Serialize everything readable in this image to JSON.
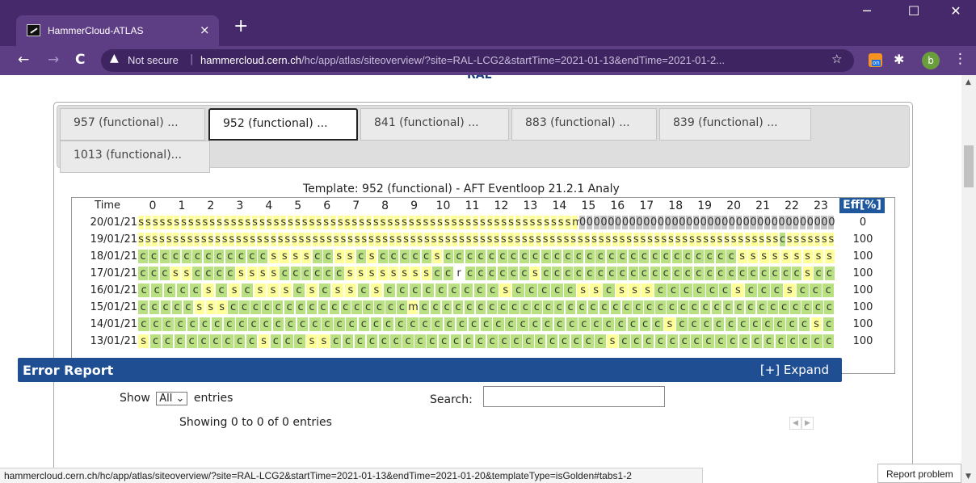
{
  "browser": {
    "tab_title": "HammerCloud-ATLAS",
    "tab_close": "×",
    "new_tab": "+",
    "window_controls": [
      "─",
      "☐",
      "✕"
    ],
    "nav": {
      "back": "←",
      "forward": "→",
      "reload": "C"
    },
    "security_label": "Not secure",
    "url_host": "hammercloud.cern.ch",
    "url_path": "/hc/app/atlas/siteoverview/?site=RAL-LCG2&startTime=2021-01-13&endTime=2021-01-2...",
    "bookmark_icon": "☆",
    "extension_badge": "on",
    "profile_initial": "b",
    "menu_icon": "⋮",
    "status_url": "hammercloud.cern.ch/hc/app/atlas/siteoverview/?site=RAL-LCG2&startTime=2021-01-13&endTime=2021-01-20&templateType=isGolden#tabs1-2"
  },
  "page": {
    "site_heading": "RAL",
    "template_tabs": [
      "957 (functional) ...",
      "952 (functional) ...",
      "841 (functional) ...",
      "883 (functional) ...",
      "839 (functional) ...",
      "1013 (functional)..."
    ],
    "active_tab": 1,
    "template_title": "Template: 952 (functional) - AFT Eventloop 21.2.1 Analy",
    "grid": {
      "time_label": "Time",
      "hours": [
        "0",
        "1",
        "2",
        "3",
        "4",
        "5",
        "6",
        "7",
        "8",
        "9",
        "10",
        "11",
        "12",
        "13",
        "14",
        "15",
        "16",
        "17",
        "18",
        "19",
        "20",
        "21",
        "22",
        "23"
      ],
      "eff_label": "Eff[%]",
      "rows": [
        {
          "date": "20/01/21",
          "eff": "0",
          "cells": "sssssssssssssssssssssssssssssssssssssssssssssssssssssssssssssm000000000000000000000000000000000000"
        },
        {
          "date": "19/01/21",
          "eff": "100",
          "cells": "sssssssssssssssssssssssssssssssssssssssssssssssssssssssssssssssssssssssssssssssssssssssssssscsssssss"
        },
        {
          "date": "18/01/21",
          "eff": "100",
          "cells": "ccccccccccccssssccsscscccccscccccccccccccccccccccccccccsssssssss"
        },
        {
          "date": "17/01/21",
          "eff": "100",
          "cells": "cccssccccssssccccccssssssssccrccccccsccccccccccccccccccccccccscc"
        },
        {
          "date": "16/01/21",
          "eff": "100",
          "cells": "cccccscscssscscsscscccccccccscccccsscsssccccccscccsccc"
        },
        {
          "date": "15/01/21",
          "eff": "100",
          "cells": "cccccsssccccccccccccccccmccccccccccccccccccccccccccccccccccccc"
        },
        {
          "date": "14/01/21",
          "eff": "100",
          "cells": "cccccccccccccccccccccccccccccccccccccccccccscccccccccccsc"
        },
        {
          "date": "13/01/21",
          "eff": "100",
          "cells": "scccccccccscccsscccccccccccccccccccccccscccccccccccccccccc"
        }
      ]
    },
    "error_report": {
      "title": "Error Report",
      "expand_label": "[+] Expand",
      "show_label": "Show",
      "show_value": "All",
      "entries_label": "entries",
      "search_label": "Search:",
      "search_value": "",
      "showing_text": "Showing 0 to 0 of 0 entries",
      "prev": "◀",
      "next": "▶"
    },
    "report_problem": "Report problem"
  },
  "colors": {
    "titlebar": "#46296a",
    "toolbar": "#5d3d84",
    "success_cell": "#b9e081",
    "submitted_cell": "#ffff99",
    "idle_cell": "#c6c6c6",
    "header_blue": "#1f4e93"
  }
}
